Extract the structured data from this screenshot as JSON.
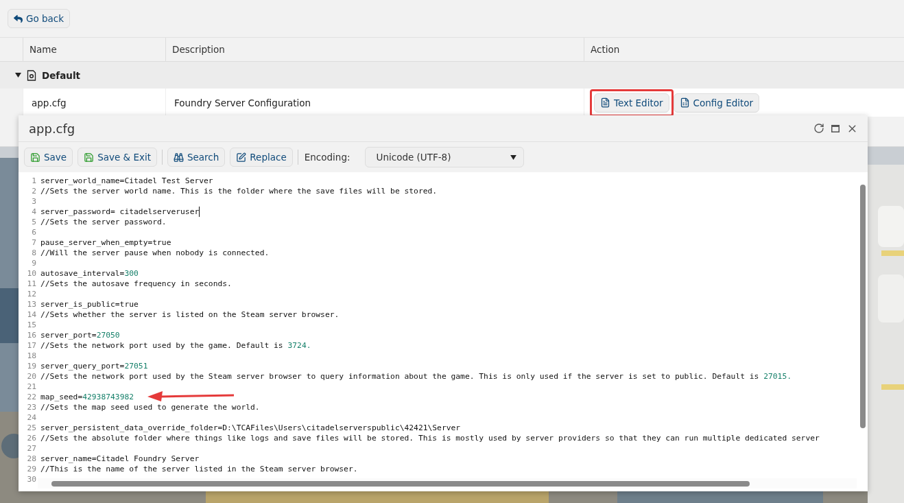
{
  "back_button": {
    "label": "Go back"
  },
  "table": {
    "columns": [
      "Name",
      "Description",
      "Action"
    ],
    "groups": [
      {
        "label": "Default",
        "expanded": true,
        "rows": [
          {
            "name": "app.cfg",
            "description": "Foundry Server Configuration",
            "actions": [
              {
                "label": "Text Editor",
                "highlighted": true
              },
              {
                "label": "Config Editor",
                "highlighted": false
              }
            ]
          }
        ]
      }
    ]
  },
  "dialog": {
    "title": "app.cfg",
    "toolbar": [
      {
        "kind": "save",
        "label": "Save"
      },
      {
        "kind": "save",
        "label": "Save & Exit"
      },
      {
        "kind": "separator"
      },
      {
        "kind": "search",
        "label": "Search"
      },
      {
        "kind": "replace",
        "label": "Replace"
      },
      {
        "kind": "separator"
      }
    ],
    "encoding": {
      "label": "Encoding:",
      "value": "Unicode (UTF-8)"
    },
    "lines": [
      {
        "number": "1",
        "cursor": false,
        "parts": [
          {
            "kind": "text",
            "text": "server_world_name=Citadel Test Server"
          }
        ]
      },
      {
        "number": "2",
        "cursor": false,
        "parts": [
          {
            "kind": "text",
            "text": "//Sets the server world name. This is the folder where the save files will be stored."
          }
        ]
      },
      {
        "number": "3",
        "cursor": false
      },
      {
        "number": "4",
        "cursor": true,
        "parts": [
          {
            "kind": "text",
            "text": "server_password= citadelserveruser"
          }
        ]
      },
      {
        "number": "5",
        "cursor": false,
        "parts": [
          {
            "kind": "text",
            "text": "//Sets the server password."
          }
        ]
      },
      {
        "number": "6",
        "cursor": false
      },
      {
        "number": "7",
        "cursor": false,
        "parts": [
          {
            "kind": "text",
            "text": "pause_server_when_empty=true"
          }
        ]
      },
      {
        "number": "8",
        "cursor": false,
        "parts": [
          {
            "kind": "text",
            "text": "//Will the server pause when nobody is connected."
          }
        ]
      },
      {
        "number": "9",
        "cursor": false
      },
      {
        "number": "10",
        "cursor": false,
        "parts": [
          {
            "kind": "text",
            "text": "autosave_interval="
          },
          {
            "kind": "number",
            "text": "300"
          }
        ]
      },
      {
        "number": "11",
        "cursor": false,
        "parts": [
          {
            "kind": "text",
            "text": "//Sets the autosave frequency in seconds."
          }
        ]
      },
      {
        "number": "12",
        "cursor": false
      },
      {
        "number": "13",
        "cursor": false,
        "parts": [
          {
            "kind": "text",
            "text": "server_is_public=true"
          }
        ]
      },
      {
        "number": "14",
        "cursor": false,
        "parts": [
          {
            "kind": "text",
            "text": "//Sets whether the server is listed on the Steam server browser."
          }
        ]
      },
      {
        "number": "15",
        "cursor": false
      },
      {
        "number": "16",
        "cursor": false,
        "parts": [
          {
            "kind": "text",
            "text": "server_port="
          },
          {
            "kind": "number",
            "text": "27050"
          }
        ]
      },
      {
        "number": "17",
        "cursor": false,
        "parts": [
          {
            "kind": "text",
            "text": "//Sets the network port used by the game. Default is "
          },
          {
            "kind": "number",
            "text": "3724."
          }
        ]
      },
      {
        "number": "18",
        "cursor": false
      },
      {
        "number": "19",
        "cursor": false,
        "parts": [
          {
            "kind": "text",
            "text": "server_query_port="
          },
          {
            "kind": "number",
            "text": "27051"
          }
        ]
      },
      {
        "number": "20",
        "cursor": false,
        "parts": [
          {
            "kind": "text",
            "text": "//Sets the network port used by the Steam server browser to query information about the game. This is only used if the server is set to public. Default is "
          },
          {
            "kind": "number",
            "text": "27015."
          }
        ]
      },
      {
        "number": "21",
        "cursor": false
      },
      {
        "number": "22",
        "cursor": false,
        "parts": [
          {
            "kind": "text",
            "text": "map_seed="
          },
          {
            "kind": "number",
            "text": "42938743982"
          }
        ]
      },
      {
        "number": "23",
        "cursor": false,
        "parts": [
          {
            "kind": "text",
            "text": "//Sets the map seed used to generate the world."
          }
        ]
      },
      {
        "number": "24",
        "cursor": false
      },
      {
        "number": "25",
        "cursor": false,
        "parts": [
          {
            "kind": "text",
            "text": "server_persistent_data_override_folder=D:\\TCAFiles\\Users\\citadelserverspublic\\42421\\Server"
          }
        ]
      },
      {
        "number": "26",
        "cursor": false,
        "parts": [
          {
            "kind": "text",
            "text": "//Sets the absolute folder where things like logs and save files will be stored. This is mostly used by server providers so that they can run multiple dedicated server"
          }
        ]
      },
      {
        "number": "27",
        "cursor": false
      },
      {
        "number": "28",
        "cursor": false,
        "parts": [
          {
            "kind": "text",
            "text": "server_name=Citadel Foundry Server"
          }
        ]
      },
      {
        "number": "29",
        "cursor": false,
        "parts": [
          {
            "kind": "text",
            "text": "//This is the name of the server listed in the Steam server browser."
          }
        ]
      },
      {
        "number": "30",
        "cursor": false
      }
    ]
  }
}
